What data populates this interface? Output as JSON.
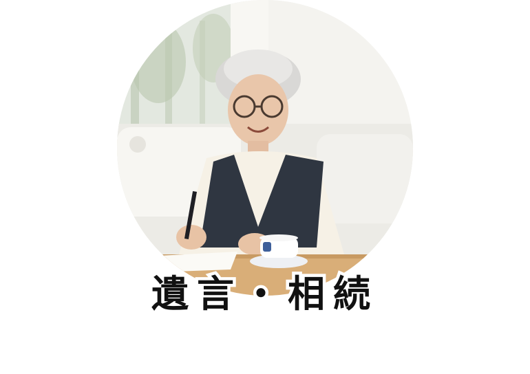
{
  "caption": "遺言・相続",
  "photo": {
    "subject": "elderly-woman-writing-photo"
  },
  "colors": {
    "background": "#ffffff",
    "caption_text": "#111111",
    "caption_outline": "#ffffff"
  }
}
